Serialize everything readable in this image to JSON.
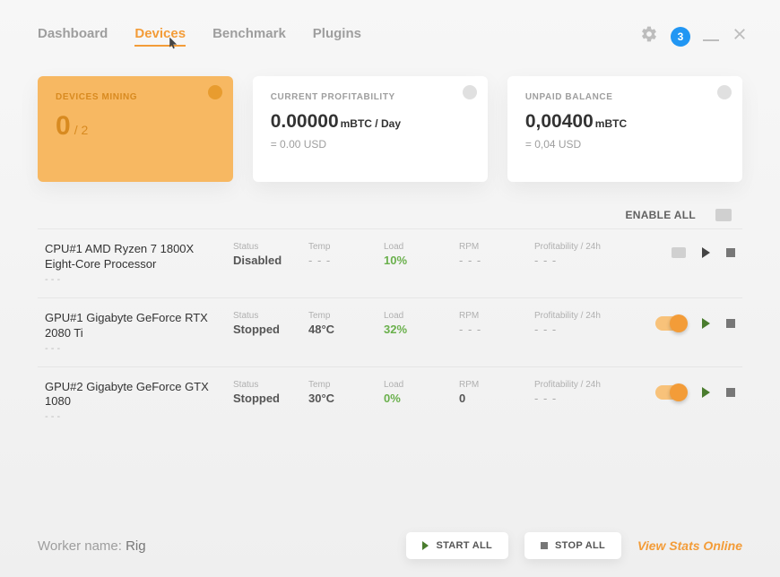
{
  "nav": {
    "items": [
      "Dashboard",
      "Devices",
      "Benchmark",
      "Plugins"
    ],
    "active_index": 1
  },
  "header": {
    "notif_count": "3"
  },
  "cards": {
    "mining": {
      "title": "DEVICES MINING",
      "count": "0",
      "total": "/ 2"
    },
    "profitability": {
      "title": "CURRENT PROFITABILITY",
      "value": "0.00000",
      "unit": "mBTC / Day",
      "sub": "= 0.00 USD"
    },
    "balance": {
      "title": "UNPAID BALANCE",
      "value": "0,00400",
      "unit": "mBTC",
      "sub": "= 0,04 USD"
    }
  },
  "enable_all_label": "ENABLE ALL",
  "stat_labels": {
    "status": "Status",
    "temp": "Temp",
    "load": "Load",
    "rpm": "RPM",
    "profit": "Profitability / 24h"
  },
  "devices": [
    {
      "name": "CPU#1 AMD Ryzen 7 1800X Eight-Core Processor",
      "sub": "- - -",
      "status": "Disabled",
      "temp": "- - -",
      "load": "10%",
      "rpm": "- - -",
      "profit": "- - -",
      "toggle_on": false,
      "show_chip": true
    },
    {
      "name": "GPU#1 Gigabyte GeForce RTX 2080 Ti",
      "sub": "- - -",
      "status": "Stopped",
      "temp": "48°C",
      "load": "32%",
      "rpm": "- - -",
      "profit": "- - -",
      "toggle_on": true,
      "show_chip": false
    },
    {
      "name": "GPU#2 Gigabyte GeForce GTX 1080",
      "sub": "- - -",
      "status": "Stopped",
      "temp": "30°C",
      "load": "0%",
      "rpm": "0",
      "profit": "- - -",
      "toggle_on": true,
      "show_chip": false
    }
  ],
  "footer": {
    "worker_label": "Worker name: ",
    "worker_name": "Rig",
    "start_all": "START ALL",
    "stop_all": "STOP ALL",
    "view_stats": "View Stats Online"
  }
}
